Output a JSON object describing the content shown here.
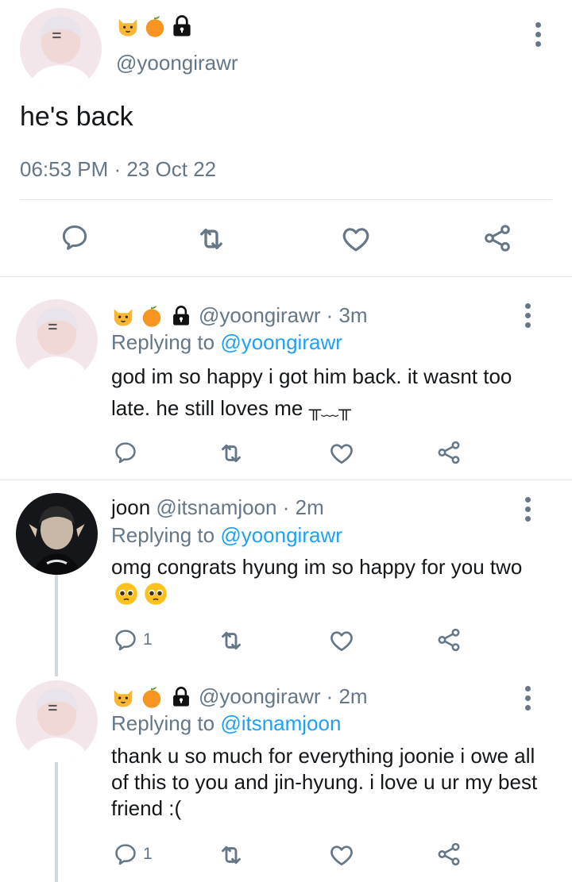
{
  "main_tweet": {
    "handle": "@yoongirawr",
    "name_emojis": [
      "cat-face",
      "tangerine",
      "lock"
    ],
    "text": "he's back",
    "timestamp": "06:53 PM · 23 Oct 22"
  },
  "replies": [
    {
      "name": "",
      "name_emojis": [
        "cat-face",
        "tangerine",
        "lock"
      ],
      "handle": "@yoongirawr",
      "time": "· 3m",
      "replying_label": "Replying to",
      "replying_to": "@yoongirawr",
      "text": "god im so happy i got him back. it wasnt too late. he still loves me",
      "kaomoji": "╥﹏╥",
      "reply_count": ""
    },
    {
      "name": "joon",
      "name_emojis": [],
      "handle": "@itsnamjoon",
      "time": "· 2m",
      "replying_label": "Replying to",
      "replying_to": "@yoongirawr",
      "text": "omg congrats hyung im so happy for you two",
      "trailing_emojis": [
        "pleading-face",
        "pleading-face"
      ],
      "reply_count": "1"
    },
    {
      "name": "",
      "name_emojis": [
        "cat-face",
        "tangerine",
        "lock"
      ],
      "handle": "@yoongirawr",
      "time": "· 2m",
      "replying_label": "Replying to",
      "replying_to": "@itsnamjoon",
      "text": "thank u so much for everything joonie i owe all of this to you and jin-hyung. i love u ur my best friend :(",
      "reply_count": "1"
    }
  ],
  "colors": {
    "link": "#1da1f2",
    "secondary_text": "#657786",
    "icon": "#657786",
    "divider": "#e1e8ed"
  },
  "icons": [
    "reply-icon",
    "retweet-icon",
    "like-icon",
    "share-icon",
    "more-options-icon"
  ]
}
